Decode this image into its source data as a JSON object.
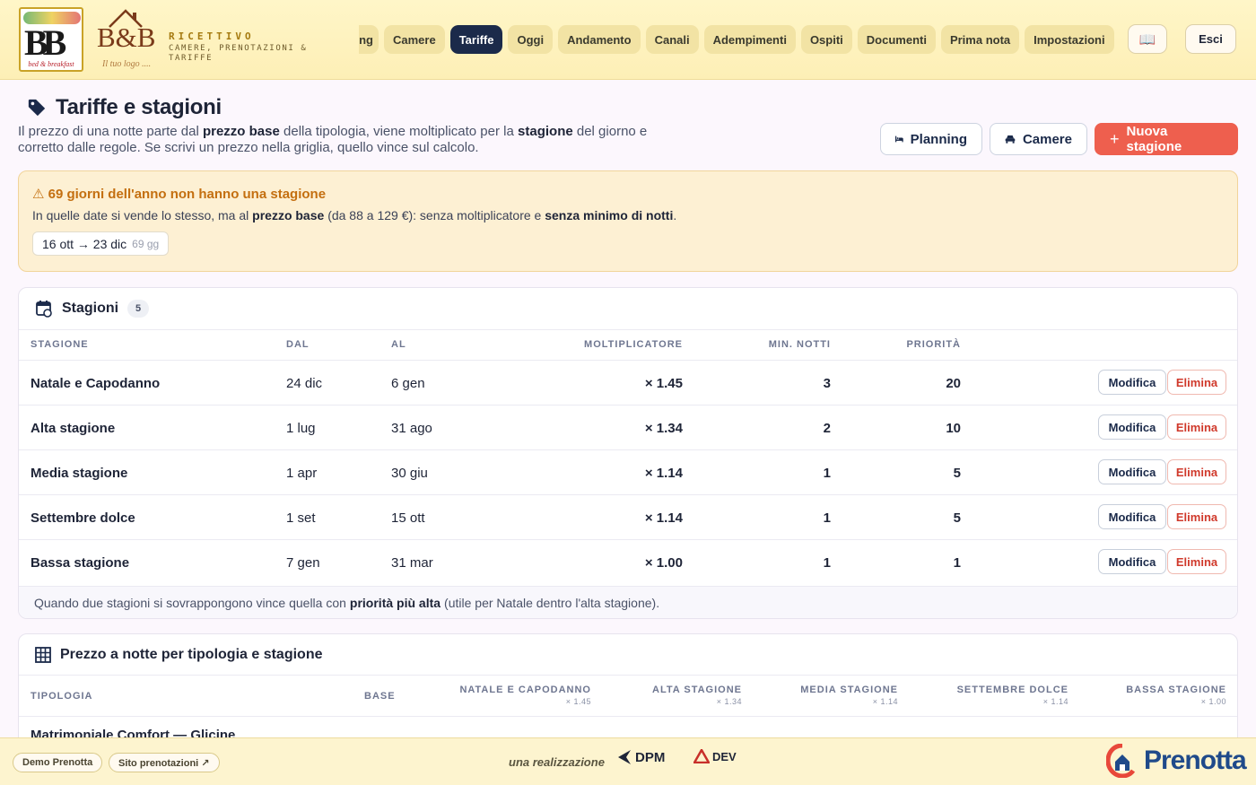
{
  "app": {
    "brand_title": "RICETTIVO",
    "brand_subtitle": "CAMERE, PRENOTAZIONI & TARIFFE",
    "logo1_text": "BB",
    "logo1_sub": "bed & breakfast",
    "logo2_text": "B&B",
    "logo2_sub": "Il tuo logo ...."
  },
  "nav": {
    "items": [
      "ng",
      "Camere",
      "Tariffe",
      "Oggi",
      "Andamento",
      "Canali",
      "Adempimenti",
      "Ospiti",
      "Documenti",
      "Prima nota",
      "Impostazioni"
    ],
    "active": "Tariffe",
    "book_icon": "book-icon",
    "exit_label": "Esci"
  },
  "page": {
    "title": "Tariffe e stagioni"
  },
  "intro": {
    "p1": "Il prezzo di una notte parte dal",
    "b1": "prezzo base",
    "p2": "della tipologia, viene moltiplicato per la",
    "b2": "stagione",
    "p3": "del giorno e corretto dalle regole. Se scrivi un prezzo nella griglia, quello vince sul calcolo."
  },
  "actions": {
    "planning": "Planning",
    "camere": "Camere",
    "new_season": "Nuova stagione"
  },
  "warning": {
    "title": "69 giorni dell'anno non hanno una stagione",
    "d1": "In quelle date si vende lo stesso, ma al",
    "b1": "prezzo base",
    "d2": "(da 88 a 129 €): senza moltiplicatore e",
    "b2": "senza minimo di notti",
    "d3": ".",
    "chip_range": "16 ott → 23 dic",
    "chip_days": "69 gg"
  },
  "seasons": {
    "title": "Stagioni",
    "count": "5",
    "headers": {
      "name": "Stagione",
      "from": "Dal",
      "to": "Al",
      "mult": "Moltiplicatore",
      "min": "Min. notti",
      "prio": "Priorità"
    },
    "rows": [
      {
        "name": "Natale e Capodanno",
        "from": "24 dic",
        "to": "6 gen",
        "mult": "× 1.45",
        "min": "3",
        "prio": "20"
      },
      {
        "name": "Alta stagione",
        "from": "1 lug",
        "to": "31 ago",
        "mult": "× 1.34",
        "min": "2",
        "prio": "10"
      },
      {
        "name": "Media stagione",
        "from": "1 apr",
        "to": "30 giu",
        "mult": "× 1.14",
        "min": "1",
        "prio": "5"
      },
      {
        "name": "Settembre dolce",
        "from": "1 set",
        "to": "15 ott",
        "mult": "× 1.14",
        "min": "1",
        "prio": "5"
      },
      {
        "name": "Bassa stagione",
        "from": "7 gen",
        "to": "31 mar",
        "mult": "× 1.00",
        "min": "1",
        "prio": "1"
      }
    ],
    "edit_label": "Modifica",
    "delete_label": "Elimina",
    "note_a": "Quando due stagioni si sovrappongono vince quella con",
    "note_b": "priorità più alta",
    "note_c": "(utile per Natale dentro l'alta stagione)."
  },
  "prices": {
    "title": "Prezzo a notte per tipologia e stagione",
    "h_type": "Tipologia",
    "h_base": "Base",
    "cols": [
      {
        "name": "Natale e Capodanno",
        "mult": "× 1.45"
      },
      {
        "name": "Alta stagione",
        "mult": "× 1.34"
      },
      {
        "name": "Media stagione",
        "mult": "× 1.14"
      },
      {
        "name": "Settembre dolce",
        "mult": "× 1.14"
      },
      {
        "name": "Bassa stagione",
        "mult": "× 1.00"
      }
    ],
    "first_row": "Matrimoniale Comfort — Glicine"
  },
  "footer": {
    "demo": "Demo Prenotta",
    "site": "Sito prenotazioni ↗",
    "credit": "una realizzazione",
    "dpm": "DPM",
    "dev": "DEV",
    "brand": "Prenotta"
  },
  "colors": {
    "accent": "#ee5f4e",
    "navy": "#1b2a4a",
    "warning": "#c46f10"
  }
}
